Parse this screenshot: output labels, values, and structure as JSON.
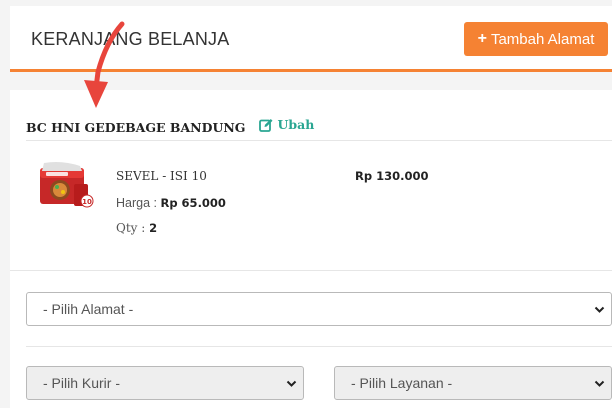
{
  "header": {
    "title": "KERANJANG BELANJA",
    "add_address_label": "Tambah Alamat",
    "accent_color": "#f58233"
  },
  "store": {
    "name": "BC HNI GEDEBAGE BANDUNG",
    "edit_label": "Ubah",
    "edit_color": "#2aa692"
  },
  "cart_item": {
    "name": "SEVEL - ISI 10",
    "price_label": "Harga : ",
    "price": "Rp 65.000",
    "qty_label": "Qty : ",
    "qty": "2",
    "subtotal": "Rp 130.000",
    "thumbnail_badge": "10"
  },
  "form": {
    "address_select": "- Pilih Alamat -",
    "courier_select": "- Pilih Kurir -",
    "service_select": "- Pilih Layanan -"
  },
  "annotation": {
    "arrow_color": "#e8453c"
  }
}
